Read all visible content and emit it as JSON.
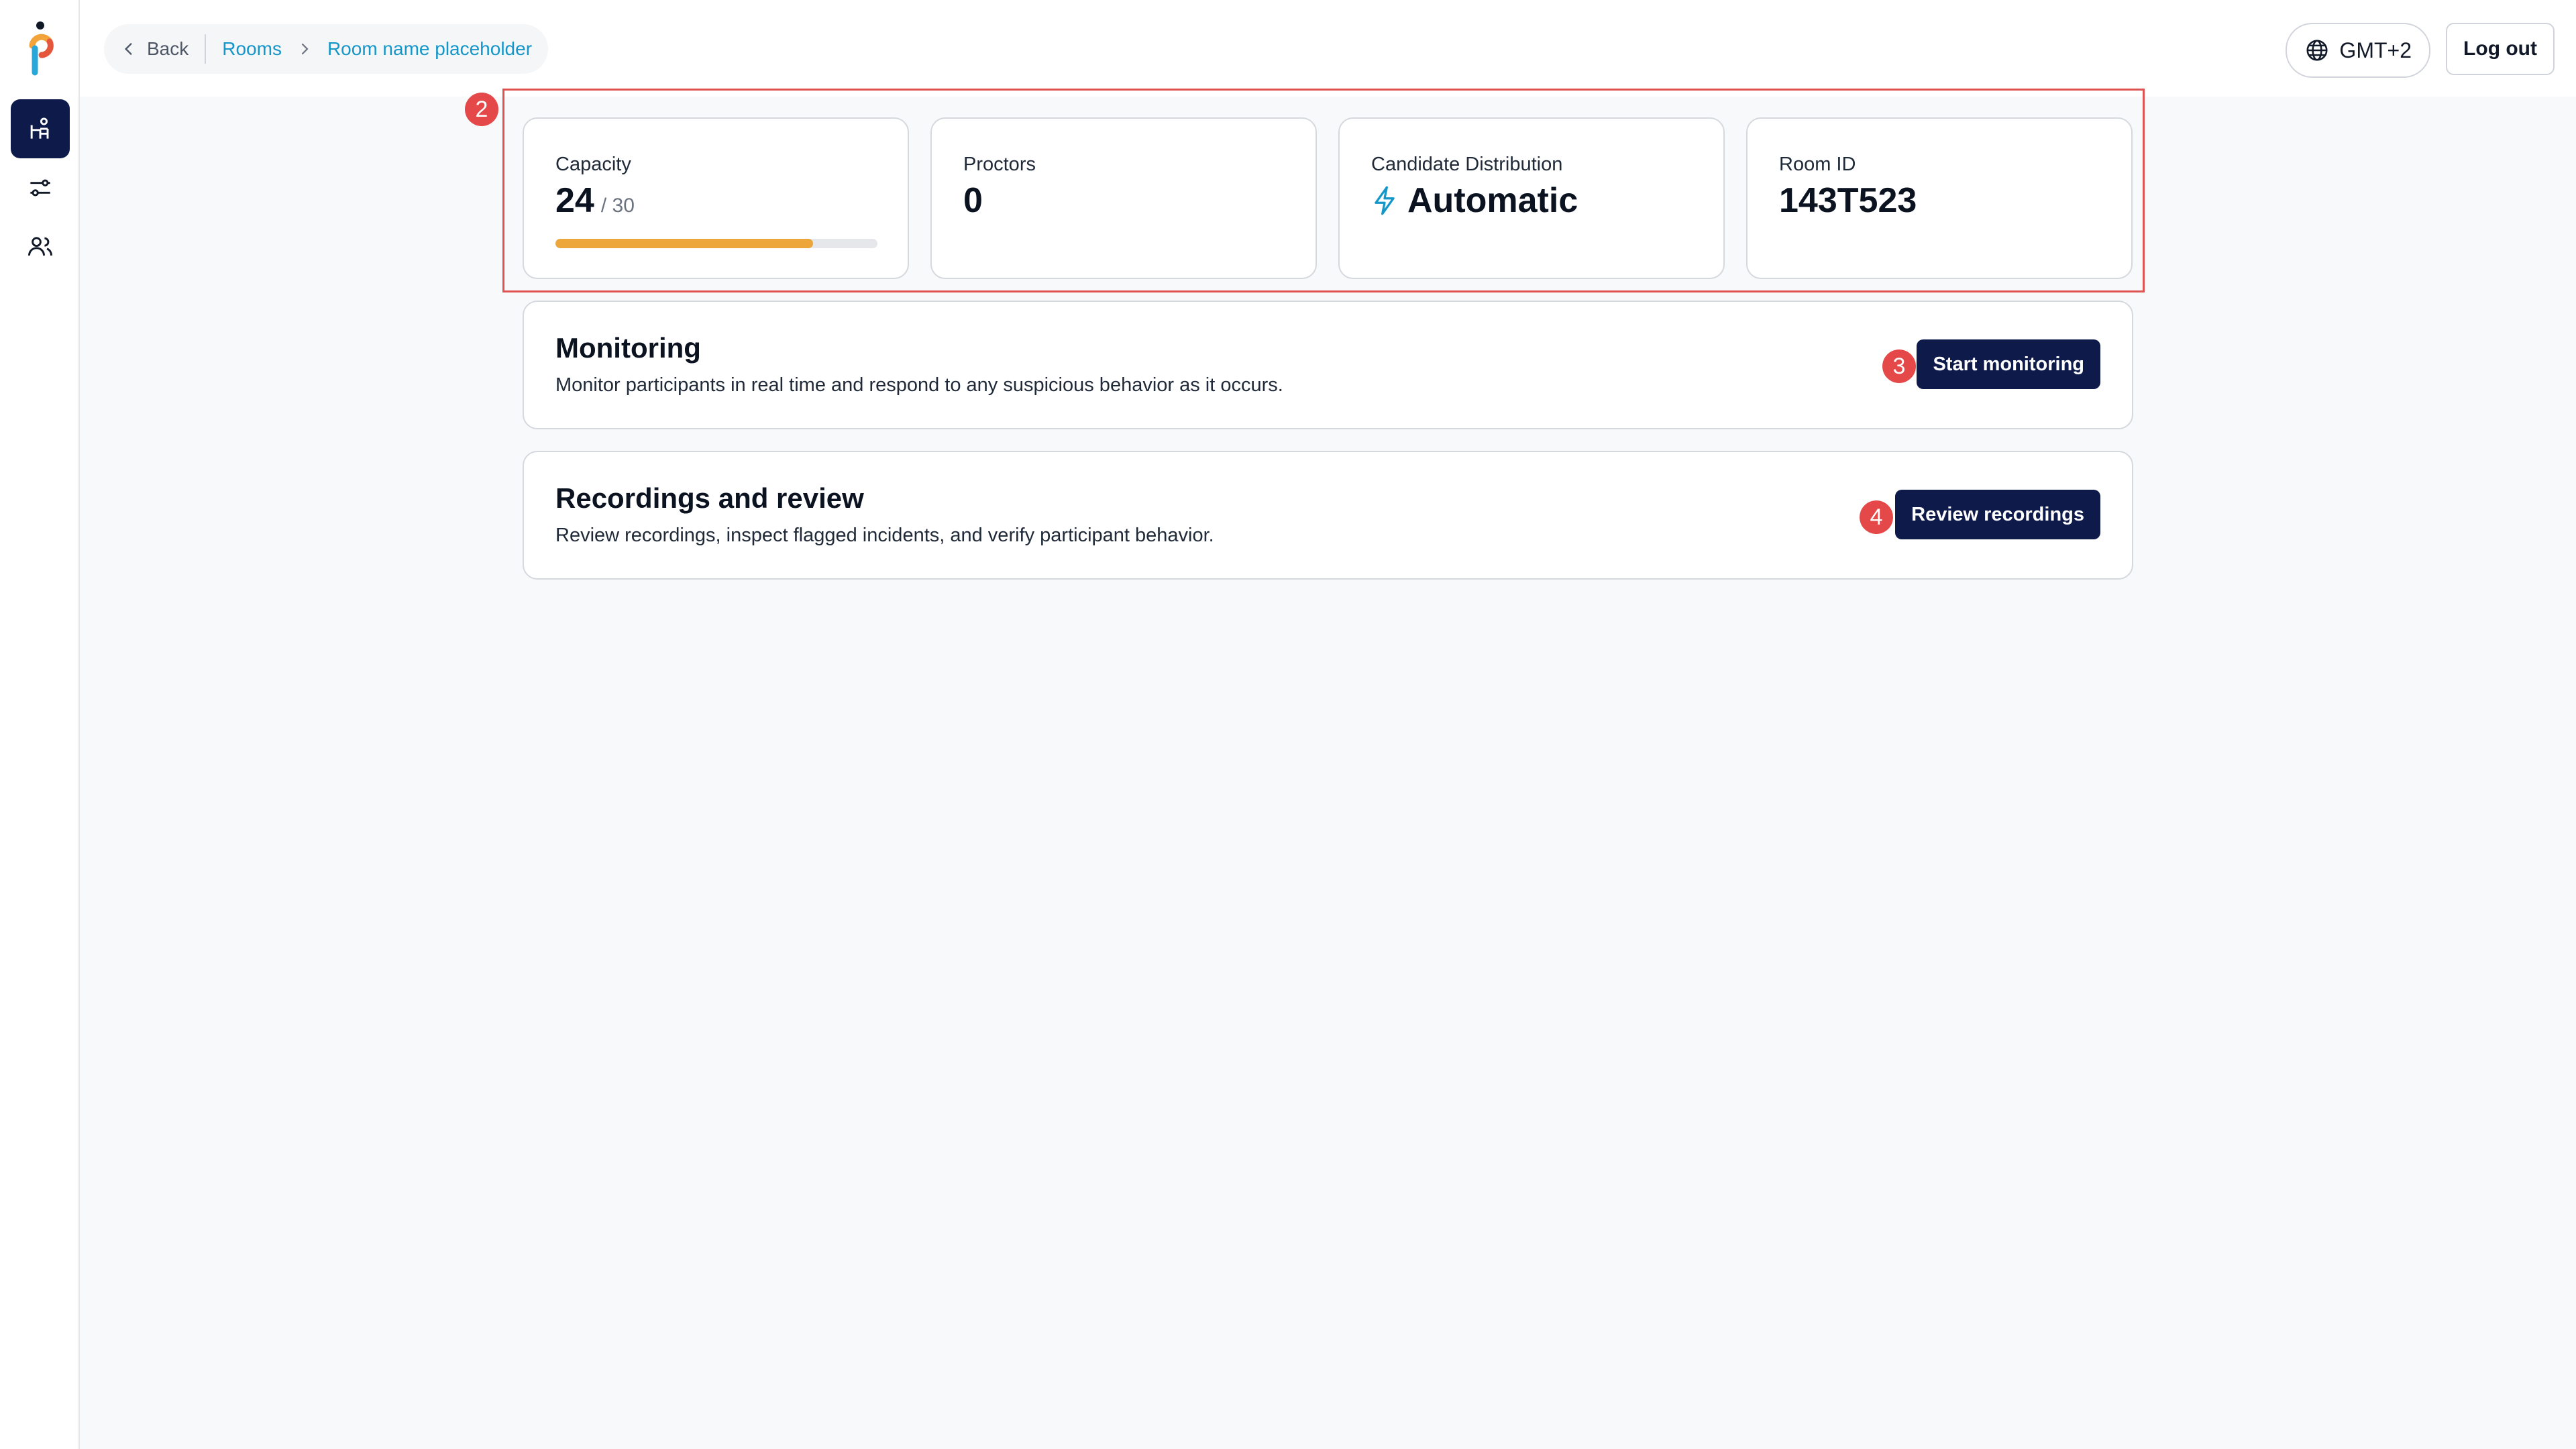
{
  "header": {
    "breadcrumb": {
      "back_label": "Back",
      "rooms_label": "Rooms",
      "current_label": "Room name placeholder"
    },
    "timezone_label": "GMT+2",
    "logout_label": "Log out"
  },
  "sidebar": {
    "items": [
      {
        "icon": "classroom-icon",
        "active": true
      },
      {
        "icon": "sliders-icon",
        "active": false
      },
      {
        "icon": "users-icon",
        "active": false
      }
    ]
  },
  "annotations": {
    "badge_2": "2",
    "badge_3": "3",
    "badge_4": "4"
  },
  "stats": {
    "capacity": {
      "label": "Capacity",
      "value": "24",
      "max": "/ 30",
      "fill_fraction": 0.8
    },
    "proctors": {
      "label": "Proctors",
      "value": "0"
    },
    "distribution": {
      "label": "Candidate Distribution",
      "value": "Automatic"
    },
    "room_id": {
      "label": "Room ID",
      "value": "143T523"
    }
  },
  "monitoring": {
    "title": "Monitoring",
    "description": "Monitor participants in real time and respond to any suspicious behavior as it occurs.",
    "button_label": "Start monitoring"
  },
  "recordings": {
    "title": "Recordings and review",
    "description": "Review recordings, inspect flagged incidents, and verify participant behavior.",
    "button_label": "Review recordings"
  },
  "colors": {
    "primary": "#0e1a4a",
    "link": "#1596c9",
    "progress": "#eda63a",
    "annotation": "#e44848"
  }
}
